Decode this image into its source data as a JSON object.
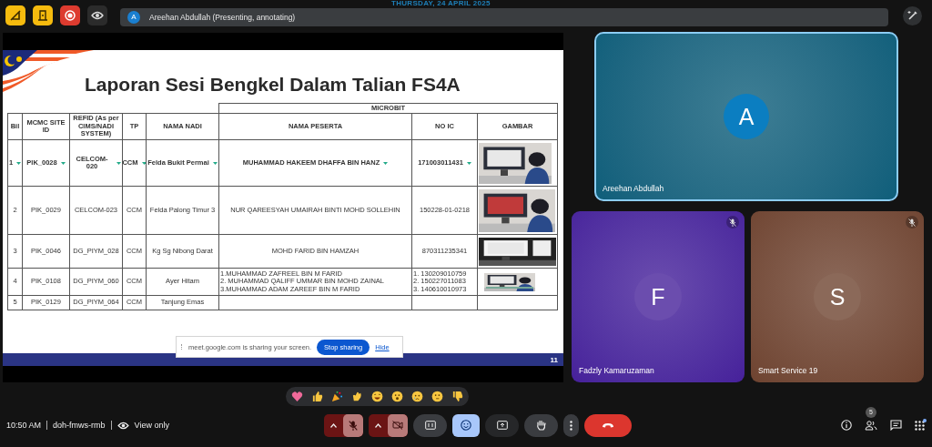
{
  "date_banner": "THURSDAY, 24 APRIL 2025",
  "top_bar": {
    "buttons": [
      {
        "kind": "no-annotate"
      },
      {
        "kind": "door"
      },
      {
        "kind": "record",
        "on": true
      },
      {
        "kind": "eye"
      }
    ],
    "presenter": {
      "initial": "A",
      "text": "Areehan Abdullah (Presenting, annotating)"
    }
  },
  "slide": {
    "title": "Laporan Sesi Bengkel Dalam Talian FS4A",
    "group_header": "MICROBIT",
    "columns": [
      "Bil",
      "MCMC SITE ID",
      "REFID (As per CIMS/NADI SYSTEM)",
      "TP",
      "NAMA NADI",
      "NAMA PESERTA",
      "NO IC",
      "GAMBAR"
    ],
    "rows": [
      {
        "kind": "filtered",
        "cells": [
          "1",
          "PIK_0028",
          "CELCOM-020",
          "CCM",
          "Felda Bukit Permai"
        ],
        "peserta": [
          "MUHAMMAD HAKEEM DHAFFA BIN HANZ"
        ],
        "ic": [
          "171003011431"
        ],
        "photo": true
      },
      {
        "kind": "plain",
        "cells": [
          "2",
          "PIK_0029",
          "CELCOM-023",
          "CCM",
          "Felda Palong Timur 3"
        ],
        "peserta": [
          "NUR QAREESYAH UMAIRAH BINTI MOHD SOLLEHIN"
        ],
        "ic": [
          "150228-01-0218"
        ],
        "photo": true
      },
      {
        "kind": "plain",
        "cells": [
          "3",
          "PIK_0046",
          "DG_PIYM_028",
          "CCM",
          "Kg Sg Nibong Darat"
        ],
        "peserta": [
          "MOHD FARID BIN HAMZAH"
        ],
        "ic": [
          "870311235341"
        ],
        "photo": true
      },
      {
        "kind": "plain",
        "cells": [
          "4",
          "PIK_0108",
          "DG_PIYM_060",
          "CCM",
          "Ayer Hitam"
        ],
        "peserta": [
          "1.MUHAMMAD ZAFREEL BIN M FARID",
          "2. MUHAMMAD QALIFF UMMAR BIN MOHD ZAINAL",
          "3.MUHAMMAD ADAM ZAREEF BIN M FARID"
        ],
        "ic": [
          "1. 130209010759",
          "2. 150227011083",
          "3. 140610010973"
        ],
        "photo": true
      },
      {
        "kind": "plain",
        "cells": [
          "5",
          "PIK_0129",
          "DG_PIYM_064",
          "CCM",
          "Tanjung Emas"
        ],
        "peserta": [],
        "ic": [],
        "photo": false
      }
    ],
    "page_number": "11"
  },
  "share_notice": {
    "text": "meet.google.com is sharing your screen.",
    "stop": "Stop sharing",
    "hide": "Hide"
  },
  "participants": [
    {
      "name": "Areehan Abdullah",
      "initial": "A",
      "color": "#0e5e7a",
      "selected": true,
      "muted": false
    },
    {
      "name": "Fadzly Kamaruzaman",
      "initial": "F",
      "color": "#46209a",
      "selected": false,
      "muted": true
    },
    {
      "name": "Smart Service 19",
      "initial": "S",
      "color": "#6e4330",
      "selected": false,
      "muted": true
    }
  ],
  "bottom_bar": {
    "time": "10:50 AM",
    "meeting_code": "doh-fmws-rmb",
    "view_label": "View only",
    "controls": [
      {
        "kind": "mic",
        "on": false
      },
      {
        "kind": "camera",
        "on": false
      },
      {
        "kind": "captions",
        "on": false
      },
      {
        "kind": "reactions",
        "on": true
      },
      {
        "kind": "present",
        "on": false
      },
      {
        "kind": "hand",
        "on": false
      },
      {
        "kind": "more"
      },
      {
        "kind": "leave"
      }
    ],
    "people_count": "5",
    "apps_notification": true
  }
}
